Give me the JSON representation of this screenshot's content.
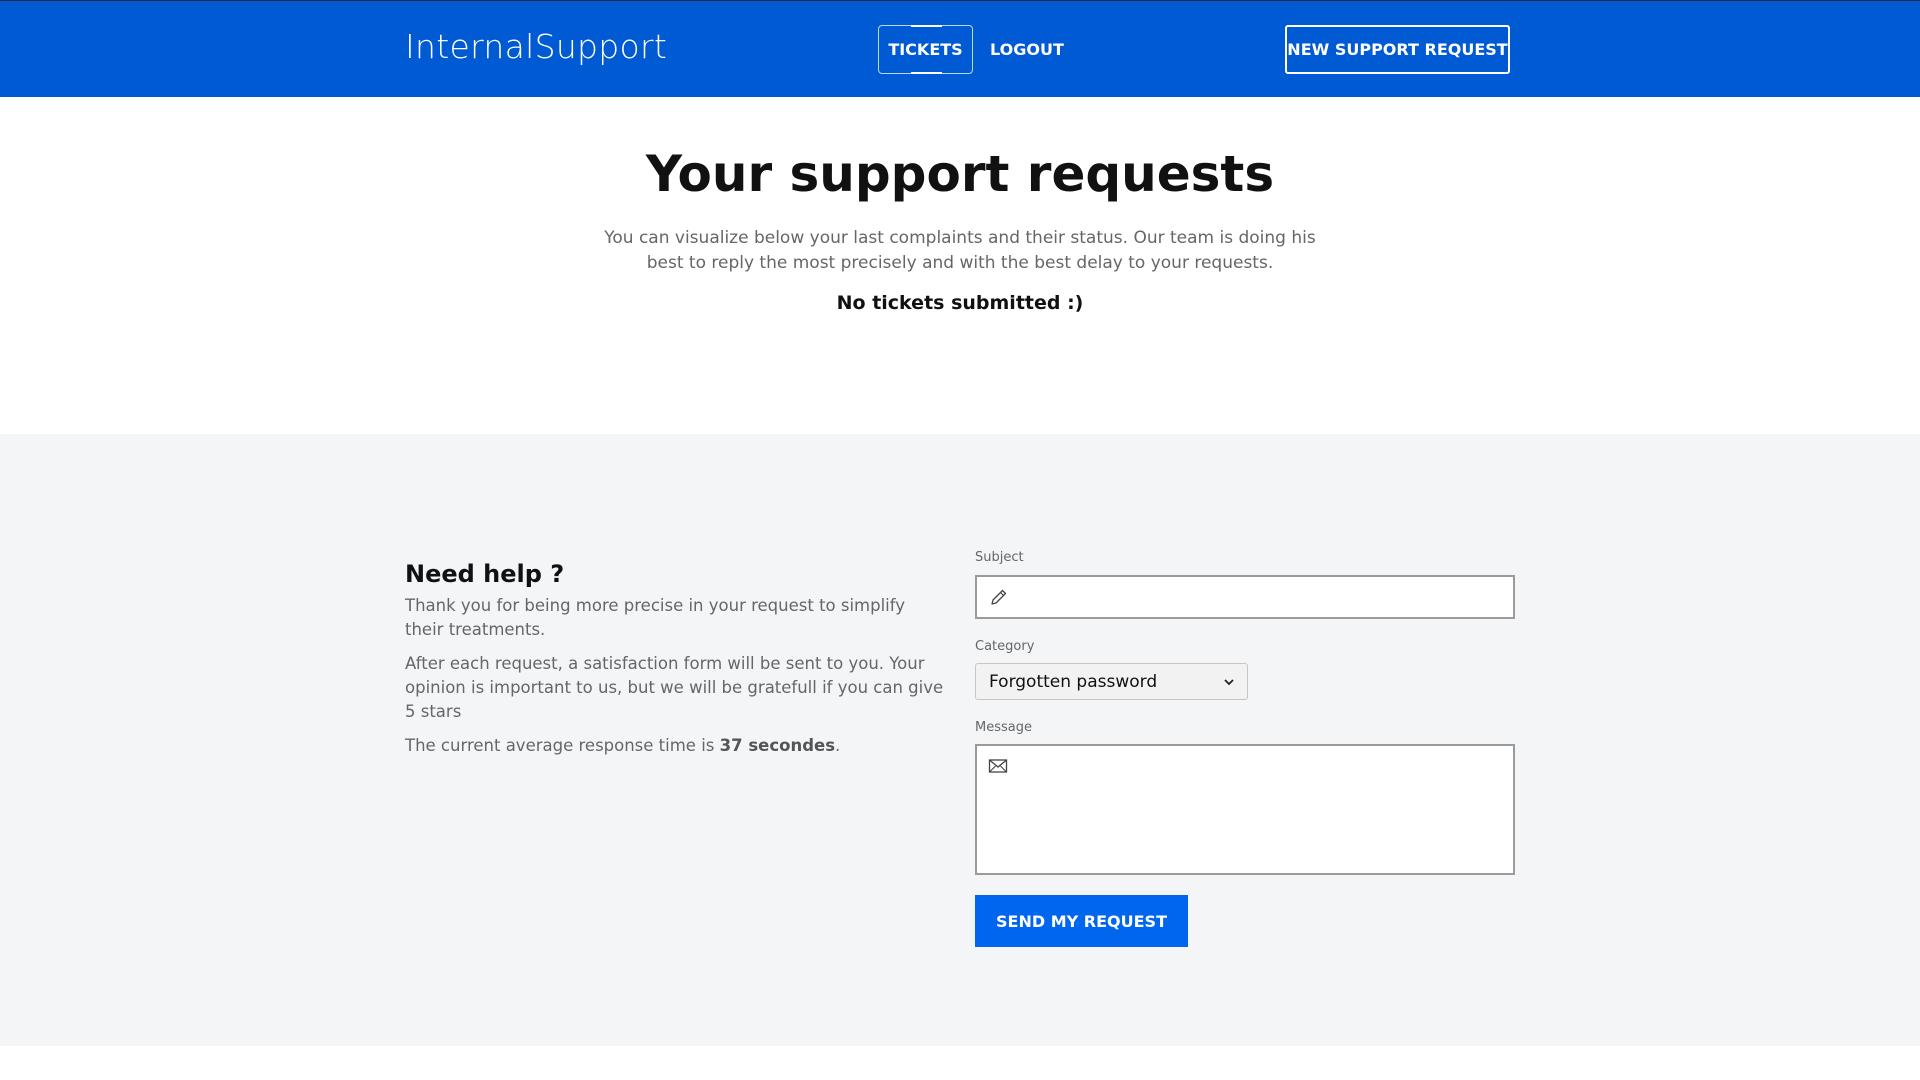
{
  "header": {
    "brand": "InternalSupport",
    "nav": {
      "tickets_label": "TICKETS",
      "logout_label": "LOGOUT"
    },
    "new_request_label": "NEW SUPPORT REQUEST"
  },
  "hero": {
    "title": "Your support requests",
    "intro": "You can visualize below your last complaints and their status. Our team is doing his best to reply the most precisely and with the best delay to your requests.",
    "empty_message": "No tickets submitted :)"
  },
  "help": {
    "title": "Need help ?",
    "paragraph1": "Thank you for being more precise in your request to simplify their treatments.",
    "paragraph2": "After each request, a satisfaction form will be sent to you. Your opinion is important to us, but we will be gratefull if you can give 5 stars",
    "response_prefix": "The current average response time is ",
    "response_value": "37 secondes",
    "response_suffix": "."
  },
  "form": {
    "subject_label": "Subject",
    "subject_value": "",
    "subject_icon": "pencil-icon",
    "category_label": "Category",
    "category_selected": "Forgotten password",
    "message_label": "Message",
    "message_value": "",
    "message_icon": "envelope-icon",
    "submit_label": "SEND MY REQUEST"
  },
  "colors": {
    "header_bg": "#005ad4",
    "primary_button": "#0066ee",
    "section_bg": "#f4f5f7"
  }
}
